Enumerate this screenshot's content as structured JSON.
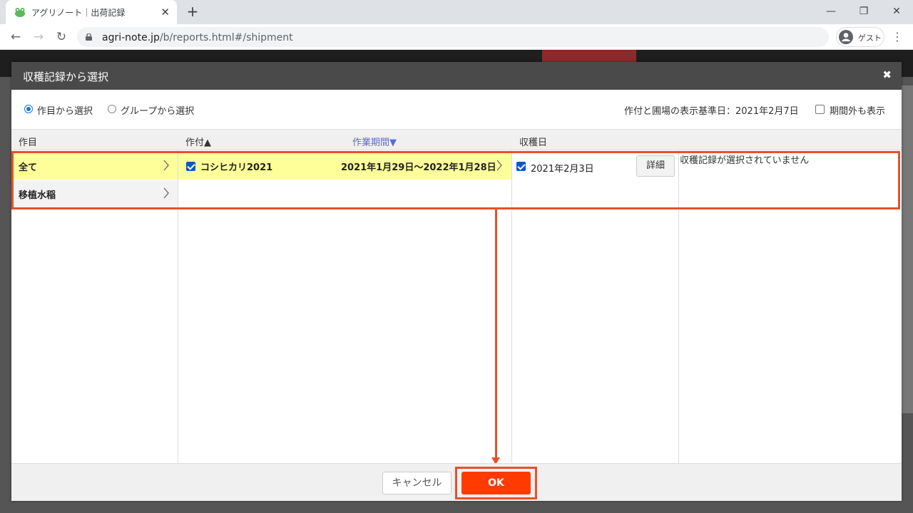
{
  "browser": {
    "tab_title": "アグリノート｜出荷記録",
    "tab_close": "✕",
    "new_tab": "+",
    "url_host": "agri-note.jp",
    "url_path": "/b/reports.html#/shipment",
    "profile_label": "ゲスト",
    "window_controls": {
      "minimize": "—",
      "restore": "❐",
      "close": "✕"
    },
    "nav": {
      "back": "←",
      "forward": "→",
      "reload": "↻"
    },
    "menu": "⋮"
  },
  "modal": {
    "title": "収穫記録から選択",
    "close": "✖",
    "options": {
      "by_crop_label": "作目から選択",
      "by_group_label": "グループから選択",
      "selected": "by_crop",
      "base_date_text": "作付と圃場の表示基準日：2021年2月7日",
      "show_out_of_period_label": "期間外も表示",
      "show_out_of_period_checked": false
    },
    "columns": {
      "crop": "作目",
      "planting": "作付▲",
      "work_period": "作業期間▼",
      "harvest_date": "収穫日"
    },
    "crops": [
      {
        "label": "全て",
        "selected": true
      },
      {
        "label": "移植水稲",
        "selected": false
      }
    ],
    "plantings": [
      {
        "name": "コシヒカリ2021",
        "period": "2021年1月29日〜2022年1月28日",
        "checked": true
      }
    ],
    "harvests": [
      {
        "date": "2021年2月3日",
        "checked": true,
        "detail_label": "詳細"
      }
    ],
    "empty_message": "収穫記録が選択されていません",
    "footer": {
      "cancel_label": "キャンセル",
      "ok_label": "OK"
    }
  },
  "colors": {
    "accent_orange": "#e8502a",
    "ok_button": "#ff3b00",
    "selected_row": "#ffff99",
    "header_dark": "#4a4a4a",
    "link_blue": "#5b6bd8"
  }
}
